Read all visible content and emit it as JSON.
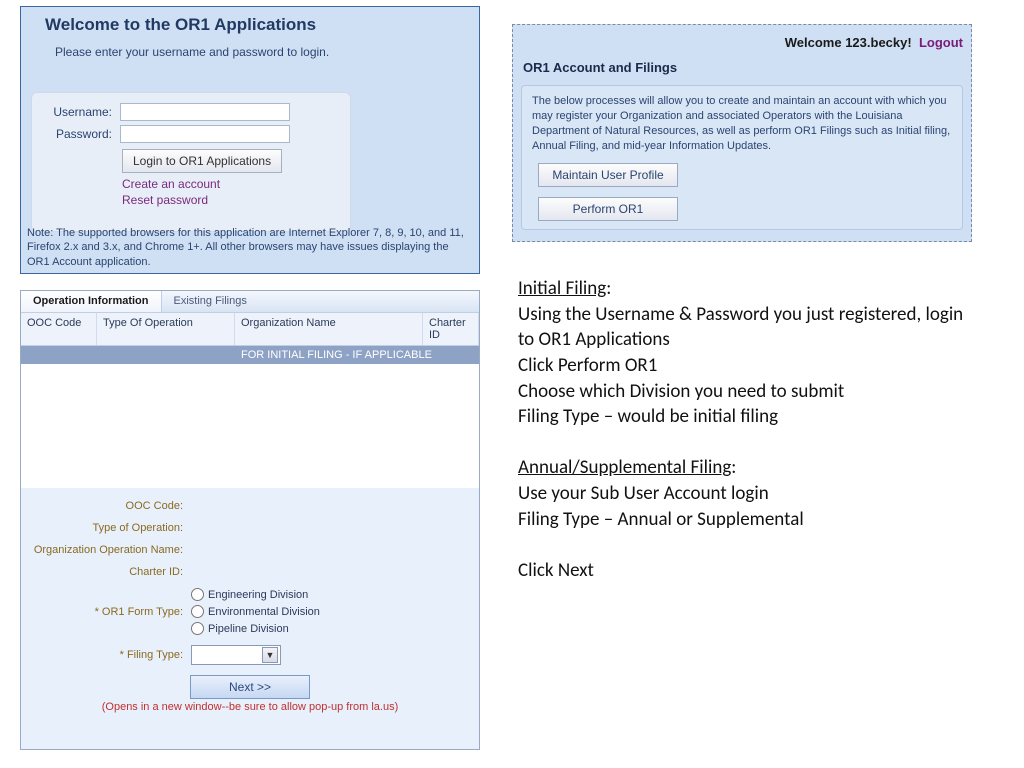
{
  "login": {
    "title": "Welcome to the OR1 Applications",
    "subtitle": "Please enter your username and password to login.",
    "username_label": "Username:",
    "password_label": "Password:",
    "button": "Login to OR1 Applications",
    "create_link": "Create an account",
    "reset_link": "Reset password",
    "note": "Note: The supported browsers for this application are Internet Explorer 7, 8, 9, 10, and 11, Firefox 2.x and 3.x, and Chrome 1+. All other browsers may have issues displaying the OR1 Account application."
  },
  "account": {
    "welcome_prefix": "Welcome ",
    "username": "123.becky",
    "welcome_suffix": "!",
    "logout": "Logout",
    "title": "OR1 Account and Filings",
    "desc": "The below processes will allow you to create and maintain an account with which you may register your Organization and associated Operators with the Louisiana Department of Natural Resources, as well as perform OR1 Filings such as Initial filing, Annual Filing, and mid-year Information Updates.",
    "btn_profile": "Maintain User Profile",
    "btn_perform": "Perform OR1"
  },
  "opinfo": {
    "tab_active": "Operation Information",
    "tab_other": "Existing Filings",
    "cols": {
      "c1": "OOC Code",
      "c2": "Type Of Operation",
      "c3": "Organization Name",
      "c4": "Charter ID"
    },
    "row_msg": "FOR INITIAL FILING - IF APPLICABLE",
    "labels": {
      "ooc": "OOC Code:",
      "type": "Type of Operation:",
      "orgname": "Organization Operation Name:",
      "charter": "Charter ID:",
      "formtype": "* OR1 Form Type:",
      "filing": "* Filing Type:"
    },
    "radios": {
      "r1": "Engineering Division",
      "r2": "Environmental Division",
      "r3": "Pipeline Division"
    },
    "next": "Next >>",
    "popup": "(Opens in a new window--be sure to allow pop-up from la.us)"
  },
  "instructions": {
    "h1": "Initial Filing",
    "h1_colon": ":",
    "l1": "Using the Username & Password you just registered, login to OR1 Applications",
    "l2": "Click Perform OR1",
    "l3": "Choose which Division you need to submit",
    "l4": "Filing Type – would be initial filing",
    "h2": "Annual/Supplemental Filing",
    "h2_colon": ":",
    "l5": "Use your Sub User Account login",
    "l6": "Filing Type – Annual or Supplemental",
    "l7": "Click Next"
  }
}
